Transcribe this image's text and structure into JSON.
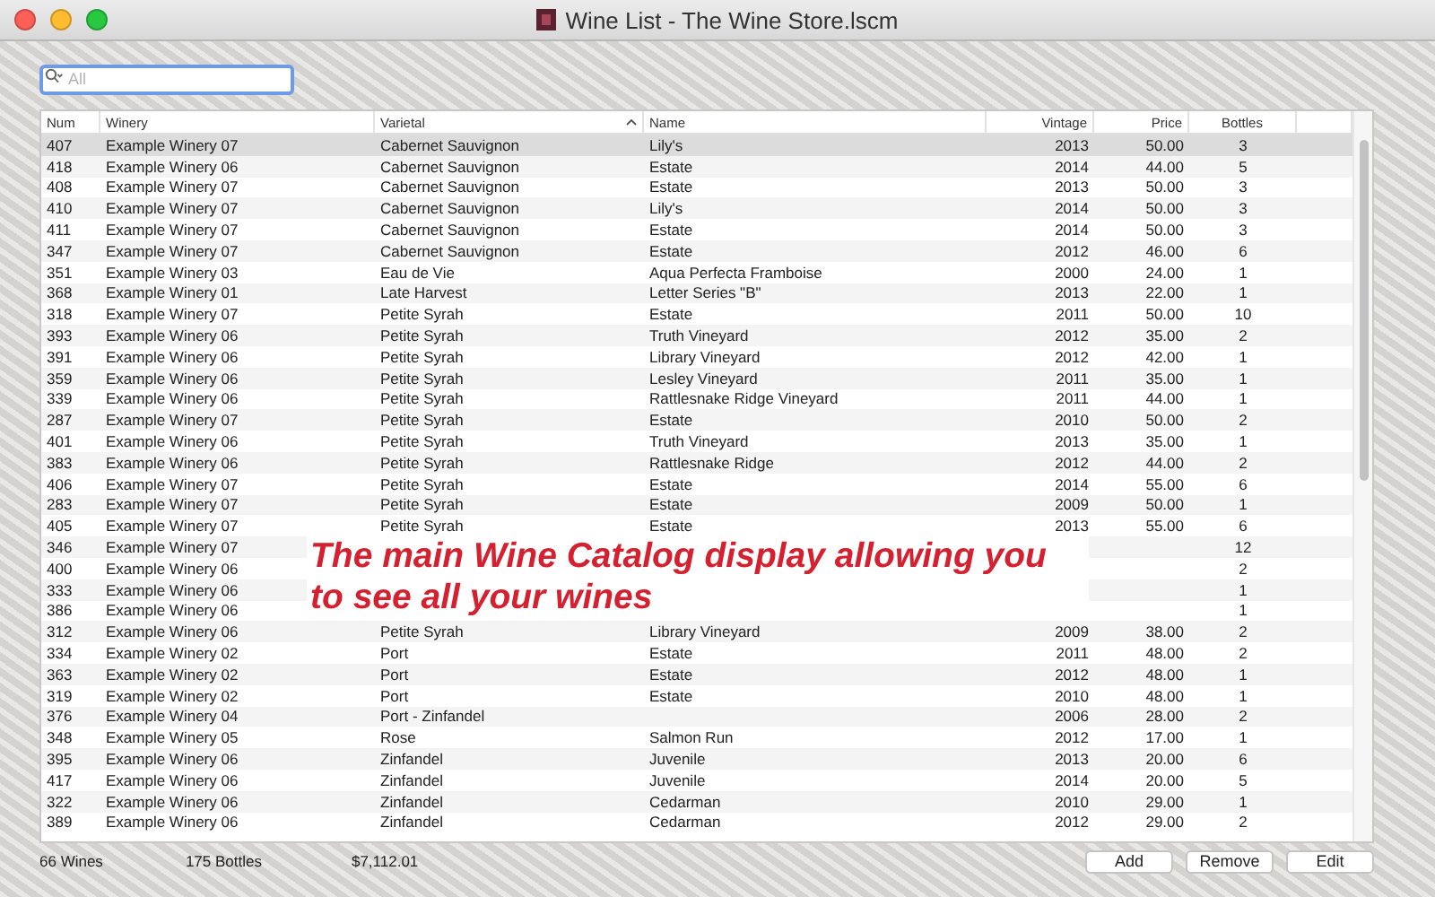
{
  "window": {
    "title": "Wine List - The Wine Store.lscm"
  },
  "search": {
    "placeholder": "All"
  },
  "table": {
    "columns": [
      {
        "label": "Num",
        "sorted": false
      },
      {
        "label": "Winery",
        "sorted": false
      },
      {
        "label": "Varietal",
        "sorted": true
      },
      {
        "label": "Name",
        "sorted": false
      },
      {
        "label": "Vintage",
        "sorted": false
      },
      {
        "label": "Price",
        "sorted": false
      },
      {
        "label": "Bottles",
        "sorted": false
      }
    ],
    "rows": [
      {
        "selected": true,
        "cells": [
          "407",
          "Example Winery 07",
          "Cabernet Sauvignon",
          "Lily's",
          "2013",
          "50.00",
          "3"
        ]
      },
      {
        "selected": false,
        "cells": [
          "418",
          "Example Winery 06",
          "Cabernet Sauvignon",
          "Estate",
          "2014",
          "44.00",
          "5"
        ]
      },
      {
        "selected": false,
        "cells": [
          "408",
          "Example Winery 07",
          "Cabernet Sauvignon",
          "Estate",
          "2013",
          "50.00",
          "3"
        ]
      },
      {
        "selected": false,
        "cells": [
          "410",
          "Example Winery 07",
          "Cabernet Sauvignon",
          "Lily's",
          "2014",
          "50.00",
          "3"
        ]
      },
      {
        "selected": false,
        "cells": [
          "411",
          "Example Winery 07",
          "Cabernet Sauvignon",
          "Estate",
          "2014",
          "50.00",
          "3"
        ]
      },
      {
        "selected": false,
        "cells": [
          "347",
          "Example Winery 07",
          "Cabernet Sauvignon",
          "Estate",
          "2012",
          "46.00",
          "6"
        ]
      },
      {
        "selected": false,
        "cells": [
          "351",
          "Example Winery 03",
          "Eau de Vie",
          "Aqua Perfecta Framboise",
          "2000",
          "24.00",
          "1"
        ]
      },
      {
        "selected": false,
        "cells": [
          "368",
          "Example Winery 01",
          "Late Harvest",
          "Letter Series \"B\"",
          "2013",
          "22.00",
          "1"
        ]
      },
      {
        "selected": false,
        "cells": [
          "318",
          "Example Winery 07",
          "Petite Syrah",
          "Estate",
          "2011",
          "50.00",
          "10"
        ]
      },
      {
        "selected": false,
        "cells": [
          "393",
          "Example Winery 06",
          "Petite Syrah",
          "Truth Vineyard",
          "2012",
          "35.00",
          "2"
        ]
      },
      {
        "selected": false,
        "cells": [
          "391",
          "Example Winery 06",
          "Petite Syrah",
          "Library Vineyard",
          "2012",
          "42.00",
          "1"
        ]
      },
      {
        "selected": false,
        "cells": [
          "359",
          "Example Winery 06",
          "Petite Syrah",
          "Lesley Vineyard",
          "2011",
          "35.00",
          "1"
        ]
      },
      {
        "selected": false,
        "cells": [
          "339",
          "Example Winery 06",
          "Petite Syrah",
          "Rattlesnake Ridge Vineyard",
          "2011",
          "44.00",
          "1"
        ]
      },
      {
        "selected": false,
        "cells": [
          "287",
          "Example Winery 07",
          "Petite Syrah",
          "Estate",
          "2010",
          "50.00",
          "2"
        ]
      },
      {
        "selected": false,
        "cells": [
          "401",
          "Example Winery 06",
          "Petite Syrah",
          "Truth Vineyard",
          "2013",
          "35.00",
          "1"
        ]
      },
      {
        "selected": false,
        "cells": [
          "383",
          "Example Winery 06",
          "Petite Syrah",
          "Rattlesnake Ridge",
          "2012",
          "44.00",
          "2"
        ]
      },
      {
        "selected": false,
        "cells": [
          "406",
          "Example Winery 07",
          "Petite Syrah",
          "Estate",
          "2014",
          "55.00",
          "6"
        ]
      },
      {
        "selected": false,
        "cells": [
          "283",
          "Example Winery 07",
          "Petite Syrah",
          "Estate",
          "2009",
          "50.00",
          "1"
        ]
      },
      {
        "selected": false,
        "cells": [
          "405",
          "Example Winery 07",
          "Petite Syrah",
          "Estate",
          "2013",
          "55.00",
          "6"
        ]
      },
      {
        "selected": false,
        "cells": [
          "346",
          "Example Winery 07",
          null,
          null,
          null,
          null,
          "12"
        ]
      },
      {
        "selected": false,
        "cells": [
          "400",
          "Example Winery 06",
          null,
          null,
          null,
          null,
          "2"
        ]
      },
      {
        "selected": false,
        "cells": [
          "333",
          "Example Winery 06",
          null,
          null,
          null,
          null,
          "1"
        ]
      },
      {
        "selected": false,
        "cells": [
          "386",
          "Example Winery 06",
          null,
          null,
          null,
          null,
          "1"
        ]
      },
      {
        "selected": false,
        "cells": [
          "312",
          "Example Winery 06",
          "Petite Syrah",
          "Library Vineyard",
          "2009",
          "38.00",
          "2"
        ]
      },
      {
        "selected": false,
        "cells": [
          "334",
          "Example Winery 02",
          "Port",
          "Estate",
          "2011",
          "48.00",
          "2"
        ]
      },
      {
        "selected": false,
        "cells": [
          "363",
          "Example Winery 02",
          "Port",
          "Estate",
          "2012",
          "48.00",
          "1"
        ]
      },
      {
        "selected": false,
        "cells": [
          "319",
          "Example Winery 02",
          "Port",
          "Estate",
          "2010",
          "48.00",
          "1"
        ]
      },
      {
        "selected": false,
        "cells": [
          "376",
          "Example Winery 04",
          "Port - Zinfandel",
          null,
          "2006",
          "28.00",
          "2"
        ]
      },
      {
        "selected": false,
        "cells": [
          "348",
          "Example Winery 05",
          "Rose",
          "Salmon Run",
          "2012",
          "17.00",
          "1"
        ]
      },
      {
        "selected": false,
        "cells": [
          "395",
          "Example Winery 06",
          "Zinfandel",
          "Juvenile",
          "2013",
          "20.00",
          "6"
        ]
      },
      {
        "selected": false,
        "cells": [
          "417",
          "Example Winery 06",
          "Zinfandel",
          "Juvenile",
          "2014",
          "20.00",
          "5"
        ]
      },
      {
        "selected": false,
        "cells": [
          "322",
          "Example Winery 06",
          "Zinfandel",
          "Cedarman",
          "2010",
          "29.00",
          "1"
        ]
      },
      {
        "selected": false,
        "cells": [
          "389",
          "Example Winery 06",
          "Zinfandel",
          "Cedarman",
          "2012",
          "29.00",
          "2"
        ]
      }
    ]
  },
  "callout": {
    "text": "The main Wine Catalog display allowing you to see all your wines"
  },
  "footer": {
    "stats": [
      "66 Wines",
      "175 Bottles",
      "$7,112.01"
    ],
    "buttons": [
      "Add",
      "Remove",
      "Edit"
    ]
  }
}
